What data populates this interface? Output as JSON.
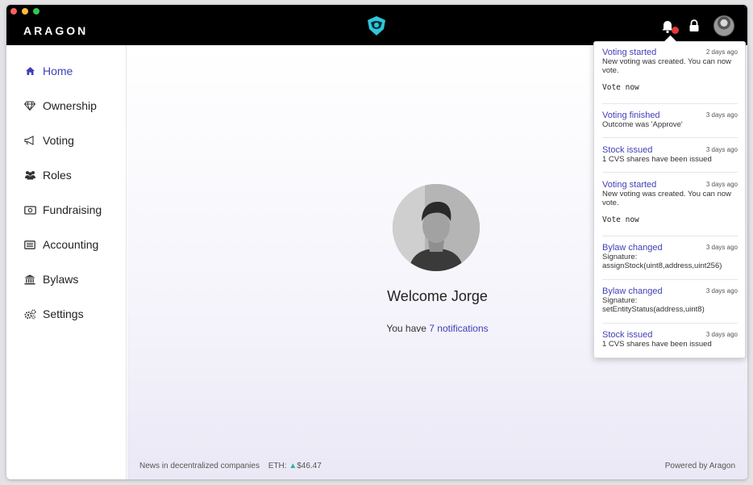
{
  "app": {
    "brand": "ARAGON"
  },
  "header": {
    "bell_icon": "bell-icon",
    "lock_icon": "lock-icon",
    "has_unread": true
  },
  "sidebar": {
    "items": [
      {
        "label": "Home",
        "icon": "home-icon",
        "active": true
      },
      {
        "label": "Ownership",
        "icon": "diamond-icon"
      },
      {
        "label": "Voting",
        "icon": "megaphone-icon"
      },
      {
        "label": "Roles",
        "icon": "users-icon"
      },
      {
        "label": "Fundraising",
        "icon": "money-icon"
      },
      {
        "label": "Accounting",
        "icon": "ledger-icon"
      },
      {
        "label": "Bylaws",
        "icon": "bank-icon"
      },
      {
        "label": "Settings",
        "icon": "gears-icon"
      }
    ]
  },
  "main": {
    "welcome": "Welcome Jorge",
    "notifications_prefix": "You have ",
    "notifications_link": "7 notifications"
  },
  "footer": {
    "news": "News in decentralized companies",
    "eth_label": "ETH:",
    "eth_arrow": "▲",
    "eth_value": "$46.47",
    "powered": "Powered by Aragon"
  },
  "notifications": [
    {
      "title": "Voting started",
      "time": "2 days ago",
      "body": "New voting was created. You can now vote.",
      "action": "Vote now"
    },
    {
      "title": "Voting finished",
      "time": "3 days ago",
      "body": "Outcome was 'Approve'"
    },
    {
      "title": "Stock issued",
      "time": "3 days ago",
      "body": "1 CVS shares have been issued"
    },
    {
      "title": "Voting started",
      "time": "3 days ago",
      "body": "New voting was created. You can now vote.",
      "action": "Vote now"
    },
    {
      "title": "Bylaw changed",
      "time": "3 days ago",
      "body": "Signature: assignStock(uint8,address,uint256)"
    },
    {
      "title": "Bylaw changed",
      "time": "3 days ago",
      "body": "Signature: setEntityStatus(address,uint8)"
    },
    {
      "title": "Stock issued",
      "time": "3 days ago",
      "body": "1 CVS shares have been issued"
    }
  ]
}
